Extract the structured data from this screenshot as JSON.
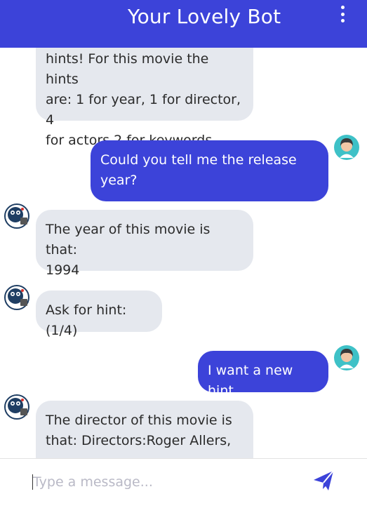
{
  "header": {
    "title": "Your Lovely Bot",
    "menu_icon": "more-vertical-icon"
  },
  "messages": [
    {
      "sender": "bot",
      "lines": [
        "hints! For this movie the hints",
        "are: 1 for year, 1 for director, 4",
        "for actors,2 for keywords"
      ]
    },
    {
      "sender": "user",
      "lines": [
        "Could you tell me the release",
        "year?"
      ]
    },
    {
      "sender": "bot",
      "lines": [
        "The year of this movie is that:",
        "1994"
      ]
    },
    {
      "sender": "bot",
      "lines": [
        "Ask for hint:(1/4)"
      ]
    },
    {
      "sender": "user",
      "lines": [
        "I want a new hint"
      ]
    },
    {
      "sender": "bot",
      "lines": [
        "The director of this movie is",
        "that: Directors:Roger Allers,"
      ]
    }
  ],
  "composer": {
    "placeholder": "Type a message...",
    "send_icon": "send-icon"
  },
  "colors": {
    "accent": "#3c43d9",
    "bot_bubble": "#e5e8ee",
    "user_avatar_bg": "#3ec1c7"
  }
}
